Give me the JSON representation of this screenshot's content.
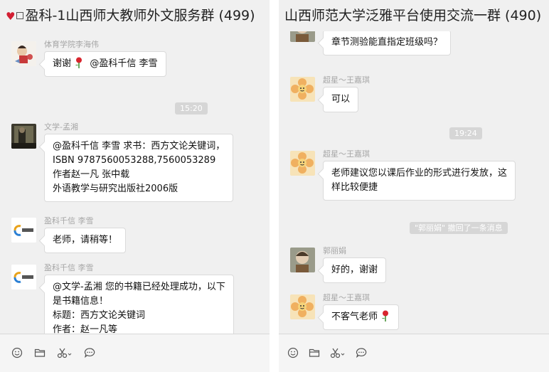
{
  "left": {
    "title_prefix_icon": "heart-icon",
    "title": "盈科-1山西师大教师外文服务群 (499)",
    "messages": [
      {
        "sender": "体育学院李海伟",
        "avatar": "avatar-character",
        "lines": [
          "谢谢",
          "@盈科千信 李雪"
        ],
        "emoji": "rose-icon"
      },
      {
        "sender": "文学-孟湘",
        "avatar": "avatar-photo",
        "lines": [
          "@盈科千信 李雪  求书：西方文论关键词，",
          "ISBN 9787560053288,7560053289",
          "作者赵一凡 张中载",
          "外语教学与研究出版社2006版"
        ]
      },
      {
        "sender": "盈科千信 李雪",
        "avatar": "avatar-logo",
        "lines": [
          "老师，请稍等！"
        ]
      },
      {
        "sender": "盈科千信 李雪",
        "avatar": "avatar-logo",
        "lines": [
          "@文学-孟湘 您的书籍已经处理成功，以下",
          "是书籍信息！",
          "标题：西方文论关键词",
          "作者：赵一凡等"
        ]
      }
    ],
    "timestamp": "15:20",
    "logo_text": "盈科千信"
  },
  "right": {
    "title": "山西师范大学泛雅平台使用交流一群 (490)",
    "messages": [
      {
        "sender": "",
        "avatar": "avatar-portrait",
        "lines": [
          "章节测验能直指定班级吗？"
        ]
      },
      {
        "sender": "超星～王嘉琪",
        "avatar": "avatar-flower",
        "lines": [
          "可以"
        ]
      },
      {
        "sender": "超星～王嘉琪",
        "avatar": "avatar-flower",
        "lines": [
          "老师建议您以课后作业的形式进行发放，这",
          "样比较便捷"
        ]
      },
      {
        "sender": "郭丽娟",
        "avatar": "avatar-portrait",
        "lines": [
          "好的，谢谢"
        ]
      },
      {
        "sender": "超星～王嘉琪",
        "avatar": "avatar-flower",
        "lines": [
          "不客气老师"
        ],
        "emoji": "rose-icon"
      }
    ],
    "timestamp": "19:24",
    "recall_notice": "\"郭丽娟\" 撤回了一条消息"
  },
  "toolbar": {
    "icons": [
      "emoji-icon",
      "folder-icon",
      "scissors-icon",
      "chat-bubble-icon"
    ]
  }
}
